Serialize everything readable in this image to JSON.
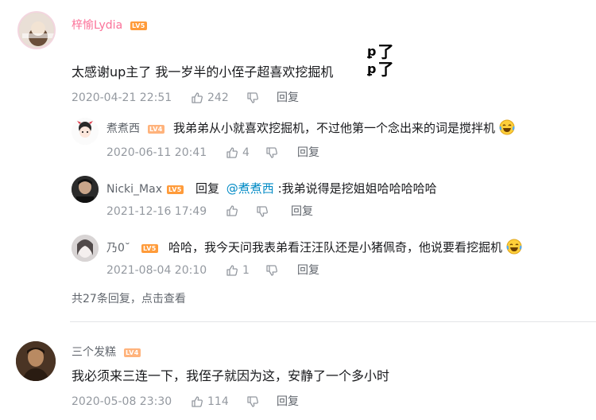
{
  "comment1": {
    "user": "梓愉Lydia",
    "level": "LV5",
    "text": "太感谢up主了 我一岁半的小侄子超喜欢挖掘机",
    "sticker_text": "了",
    "time": "2020-04-21 22:51",
    "likes": "242",
    "reply_label": "回复",
    "replies": [
      {
        "user": "煮煮西",
        "level": "LV4",
        "text": "我弟弟从小就喜欢挖掘机，不过他第一个念出来的词是搅拌机",
        "time": "2020-06-11 20:41",
        "likes": "4",
        "reply_label": "回复"
      },
      {
        "user": "Nicki_Max",
        "level": "LV5",
        "reply_prefix": "回复",
        "mention": "@煮煮西",
        "text": ":我弟说得是挖姐姐哈哈哈哈哈",
        "time": "2021-12-16 17:49",
        "likes": "",
        "reply_label": "回复"
      },
      {
        "user": "乃0˘",
        "level": "LV5",
        "text": "哈哈，我今天问我表弟看汪汪队还是小猪佩奇，他说要看挖掘机",
        "time": "2021-08-04 20:10",
        "likes": "1",
        "reply_label": "回复"
      }
    ],
    "more": {
      "count_text": "共27条回复，",
      "link_text": "点击查看"
    }
  },
  "comment2": {
    "user": "三个发糕",
    "level": "LV4",
    "text": "我必须来三连一下，我侄子就因为这，安静了一个多小时",
    "time": "2020-05-08 23:30",
    "likes": "114",
    "reply_label": "回复"
  },
  "colors": {
    "vip_name": "#fb7299",
    "name": "#61666d",
    "meta": "#9499a0",
    "mention": "#008ac5",
    "level5": "#ff9b3a",
    "level4": "#ffb37c"
  },
  "icons": {
    "like": "thumbs-up-icon",
    "dislike": "thumbs-down-icon",
    "emoji": "laughing-tears-emoji"
  }
}
